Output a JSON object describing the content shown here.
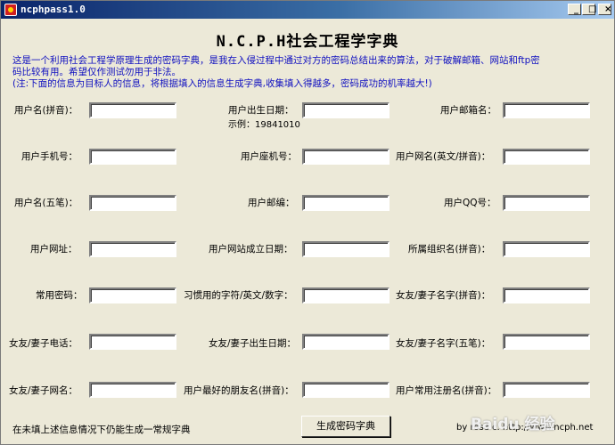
{
  "window": {
    "title": "ncphpass1.0",
    "buttons": {
      "minimize": "_",
      "maximize": "□",
      "close": "×"
    }
  },
  "heading": "N.C.P.H社会工程学字典",
  "intro": [
    "这是一个利用社会工程学原理生成的密码字典，是我在入侵过程中通过对方的密码总结出来的算法，对于破解邮箱、网站和ftp密",
    "码比较有用。希望仅作测试勿用于非法。",
    "(注:下面的信息为目标人的信息，将根据填入的信息生成字典,收集填入得越多，密码成功的机率越大!)"
  ],
  "fields": [
    {
      "label": "用户名(拼音)：",
      "value": ""
    },
    {
      "label": "用户出生日期：",
      "value": ""
    },
    {
      "label": "用户邮箱名：",
      "value": ""
    },
    {
      "label": "用户手机号：",
      "value": ""
    },
    {
      "label": "用户座机号：",
      "value": ""
    },
    {
      "label": "用户网名(英文/拼音)：",
      "value": ""
    },
    {
      "label": "用户名(五笔)：",
      "value": ""
    },
    {
      "label": "用户邮编：",
      "value": ""
    },
    {
      "label": "用户QQ号：",
      "value": ""
    },
    {
      "label": "用户网址：",
      "value": ""
    },
    {
      "label": "用户网站成立日期：",
      "value": ""
    },
    {
      "label": "所属组织名(拼音)：",
      "value": ""
    },
    {
      "label": "常用密码：",
      "value": ""
    },
    {
      "label": "习惯用的字符/英文/数字：",
      "value": ""
    },
    {
      "label": "女友/妻子名字(拼音)：",
      "value": ""
    },
    {
      "label": "女友/妻子电话：",
      "value": ""
    },
    {
      "label": "女友/妻子出生日期：",
      "value": ""
    },
    {
      "label": "女友/妻子名字(五笔)：",
      "value": ""
    },
    {
      "label": "女友/妻子网名：",
      "value": ""
    },
    {
      "label": "用户最好的朋友名(拼音)：",
      "value": ""
    },
    {
      "label": "用户常用注册名(拼音)：",
      "value": ""
    }
  ],
  "birth_example": "示例：19841010",
  "footnote": "在未填上述信息情况下仍能生成一常规字典",
  "generate_button": "生成密码字典",
  "credit": "by rose c. http://www.ncph.net",
  "watermark": "Baidu 经验"
}
